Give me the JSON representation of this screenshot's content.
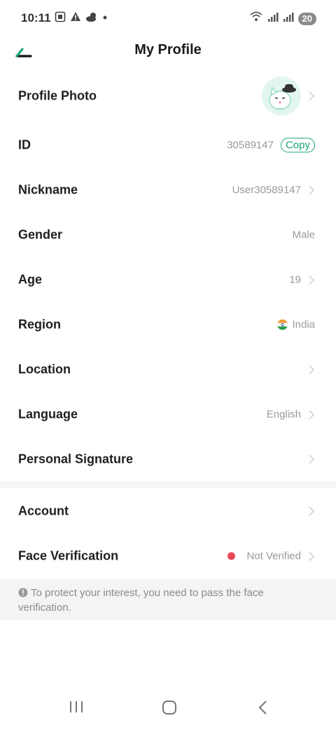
{
  "status_bar": {
    "time": "10:11",
    "battery": "20"
  },
  "header": {
    "title": "My Profile"
  },
  "rows": [
    {
      "label": "Profile Photo"
    },
    {
      "label": "ID",
      "value": "30589147",
      "action": "Copy"
    },
    {
      "label": "Nickname",
      "value": "User30589147"
    },
    {
      "label": "Gender",
      "value": "Male"
    },
    {
      "label": "Age",
      "value": "19"
    },
    {
      "label": "Region",
      "value": "India"
    },
    {
      "label": "Location"
    },
    {
      "label": "Language",
      "value": "English"
    },
    {
      "label": "Personal Signature"
    },
    {
      "label": "Account"
    },
    {
      "label": "Face Verification",
      "value": "Not Verified"
    }
  ],
  "notice": {
    "text": "To protect your interest, you need to pass the face verification."
  },
  "colors": {
    "accent": "#18a37a",
    "status_red": "#e8485a",
    "value_gray": "#9a9a9a"
  },
  "icons": [
    "back-arrow-icon",
    "chevron-right-icon",
    "info-icon",
    "india-flag-icon",
    "recent-apps-icon",
    "home-icon",
    "back-nav-icon"
  ]
}
